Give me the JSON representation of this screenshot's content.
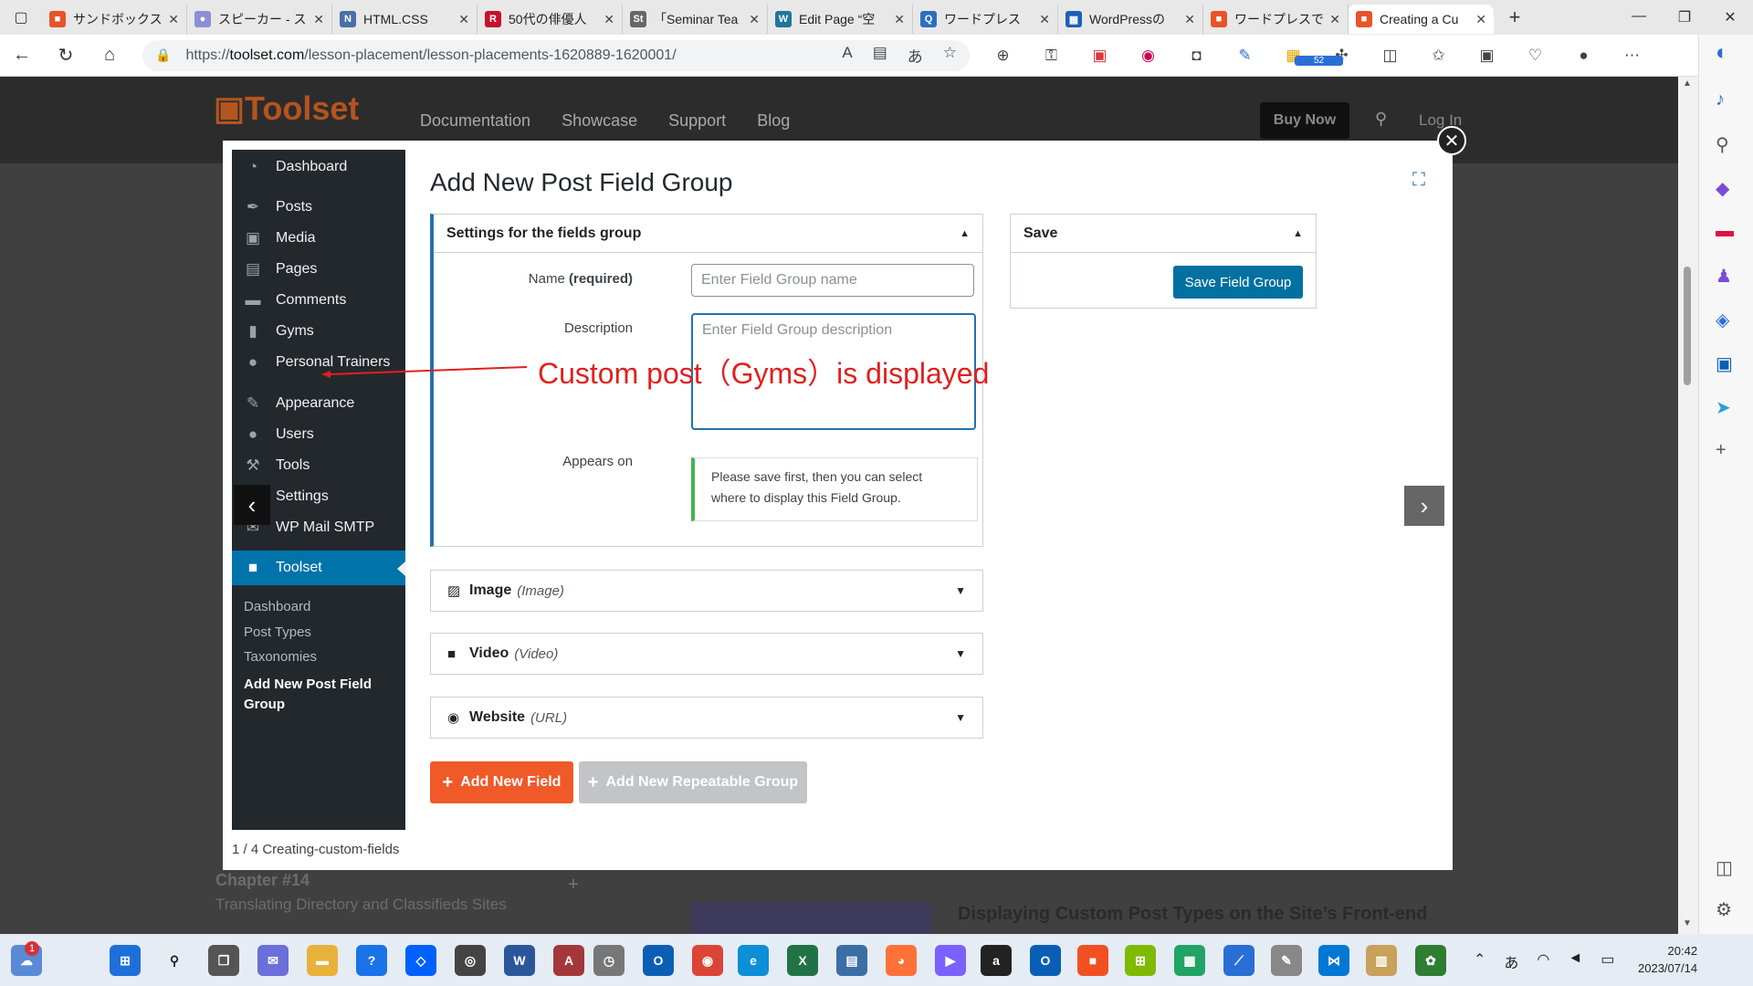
{
  "browser": {
    "tabs": [
      {
        "title": "サンドボックスで",
        "color": "#e8542a",
        "glyph": "■"
      },
      {
        "title": "スピーカー - スト",
        "color": "#8c8fd6",
        "glyph": "●"
      },
      {
        "title": "HTML.CSS",
        "color": "#4a6fa5",
        "glyph": "N"
      },
      {
        "title": "50代の俳優人",
        "color": "#c8102e",
        "glyph": "R"
      },
      {
        "title": "「Seminar Tea",
        "color": "#666",
        "glyph": "St"
      },
      {
        "title": "Edit Page “空",
        "color": "#21759b",
        "glyph": "W"
      },
      {
        "title": "ワードプレス",
        "color": "#2c6ebf",
        "glyph": "Q"
      },
      {
        "title": "WordPressの",
        "color": "#1e5fb4",
        "glyph": "▦"
      },
      {
        "title": "ワードプレスで",
        "color": "#e8542a",
        "glyph": "■"
      },
      {
        "title": "Creating a Cu",
        "color": "#e8542a",
        "glyph": "■"
      }
    ],
    "url_prefix": "https://",
    "url_domain": "toolset.com",
    "url_path": "/lesson-placement/lesson-placements-1620889-1620001/",
    "extension_badge": "52"
  },
  "site": {
    "logo": "Toolset",
    "nav": [
      "Documentation",
      "Showcase",
      "Support",
      "Blog"
    ],
    "buy_now": "Buy Now",
    "login": "Log In",
    "bg_chapter_title": "Chapter #14",
    "bg_chapter_sub": "Translating Directory and Classifieds Sites",
    "bg_right_heading": "Displaying Custom Post Types on the Site’s Front-end"
  },
  "wp": {
    "menu": [
      {
        "label": "Dashboard",
        "icon": "◔"
      },
      {
        "label": "Posts",
        "icon": "✒"
      },
      {
        "label": "Media",
        "icon": "▣"
      },
      {
        "label": "Pages",
        "icon": "▤"
      },
      {
        "label": "Comments",
        "icon": "▬"
      },
      {
        "label": "Gyms",
        "icon": "▮"
      },
      {
        "label": "Personal Trainers",
        "icon": "●"
      },
      {
        "label": "Appearance",
        "icon": "✎"
      },
      {
        "label": "Users",
        "icon": "●"
      },
      {
        "label": "Tools",
        "icon": "⚒"
      },
      {
        "label": "Settings",
        "icon": "▦"
      },
      {
        "label": "WP Mail SMTP",
        "icon": "✉"
      },
      {
        "label": "Toolset",
        "icon": "■"
      }
    ],
    "submenu": [
      "Dashboard",
      "Post Types",
      "Taxonomies",
      "Add New Post Field Group"
    ],
    "page_title": "Add New Post Field Group",
    "settings_box_title": "Settings for the fields group",
    "name_label": "Name",
    "name_required": "(required)",
    "name_placeholder": "Enter Field Group name",
    "description_label": "Description",
    "description_placeholder": "Enter Field Group description",
    "appears_on_label": "Appears on",
    "appears_on_note": "Please save first, then you can select where to display this Field Group.",
    "save_box_title": "Save",
    "save_button": "Save Field Group",
    "fields": [
      {
        "name": "Image",
        "type": "(Image)",
        "icon": "▨"
      },
      {
        "name": "Video",
        "type": "(Video)",
        "icon": "▶"
      },
      {
        "name": "Website",
        "type": "(URL)",
        "icon": "◉"
      }
    ],
    "add_new_field": "Add New Field",
    "add_repeatable": "Add New Repeatable Group"
  },
  "lightbox": {
    "caption": "1 / 4 Creating-custom-fields",
    "annotation": "Custom post（Gyms）is displayed"
  },
  "taskbar": {
    "time": "20:42",
    "date": "2023/07/14",
    "ime": "あ",
    "notification_count": "1"
  }
}
